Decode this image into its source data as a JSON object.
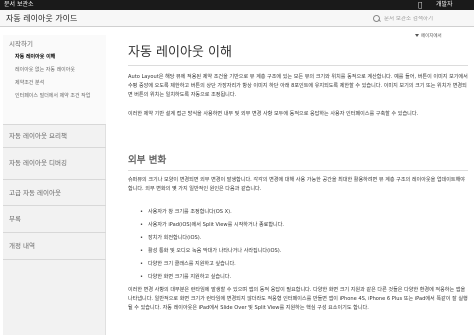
{
  "topbar": {
    "label": "문서 보관소",
    "apple_icon": "apple-logo-icon",
    "developer": "개발자"
  },
  "header": {
    "title": "자동 레이아웃 가이드",
    "search_placeholder": "문서 보관소 검색하기"
  },
  "sidebar": {
    "sections": [
      {
        "title": "시작하기",
        "items": [
          {
            "label": "자동 레이아웃 이해",
            "active": true
          },
          {
            "label": "레이아웃 없는 자동 레이아웃",
            "active": false
          },
          {
            "label": "제약조건 분석",
            "active": false
          },
          {
            "label": "인터페이스 빌더에서 제약 조건 작업",
            "active": false
          }
        ]
      },
      {
        "title": "자동 레이아웃 요리책"
      },
      {
        "title": "자동 레이아웃 디버깅"
      },
      {
        "title": "고급 자동 레이아웃"
      },
      {
        "title": "부록"
      },
      {
        "title": "개정 내역"
      }
    ]
  },
  "mini_toc": "페이지에서",
  "main": {
    "page_title": "자동 레이아웃 이해",
    "intro_1": "Auto Layout은 해당 뷰에 적용된 제약 조건을 기반으로 뷰 계층 구조에 있는 모든 뷰의 크기와 위치를 동적으로 계산합니다. 예를 들어, 버튼이 이미지 보기에서 수평 중앙에 오도록 제한하고 버튼의 상단 가장자리가 항상 이미지 하단 아래 8포인트에 유지되도록 제한할 수 있습니다. 이미지 보기의 크기 또는 위치가 변경되면 버튼의 위치는 일치하도록 자동으로 조정됩니다.",
    "intro_2": "이러한 제약 기반 설계 접근 방식을 사용하면 내부 및 외부 변경 사항 모두에 동적으로 응답하는 사용자 인터페이스를 구축할 수 있습니다.",
    "section_heading": "외부 변화",
    "external_intro": "슈퍼뷰의 크기나 모양이 변경되면 외부 변경이 발생합니다. 각각의 변경에 대해 사용 가능한 공간을 최대한 활용하려면 뷰 계층 구조의 레이아웃을 업데이트해야 합니다. 외부 변화의 몇 가지 일반적인 원인은 다음과 같습니다.",
    "bullets": [
      "사용자가 창 크기를 조정합니다(OS X).",
      "사용자가 iPad(iOS)에서 Split View를 시작하거나 종료합니다.",
      "장치가 회전합니다(iOS).",
      "활성 통화 및 오디오 녹음 막대가 나타나거나 사라집니다(iOS).",
      "다양한 크기 클래스를 지원하고 싶습니다.",
      "다양한 화면 크기를 지원하고 싶습니다."
    ],
    "closing": "이러한 변경 사항의 대부분은 런타임에 발생할 수 있으며 앱의 동적 응답이 필요합니다. 다양한 화면 크기 지원과 같은 다른 것들은 다양한 환경에 적응하는 앱을 나타냅니다. 일반적으로 화면 크기가 런타임에 변경되지 않더라도 적응형 인터페이스를 만들면 앱이 iPhone 4S, iPhone 6 Plus 또는 iPad에서 똑같이 잘 실행될 수 있습니다. 자동 레이아웃은 iPad에서 Slide Over 및 Split View를 지원하는 핵심 구성 요소이기도 합니다."
  }
}
